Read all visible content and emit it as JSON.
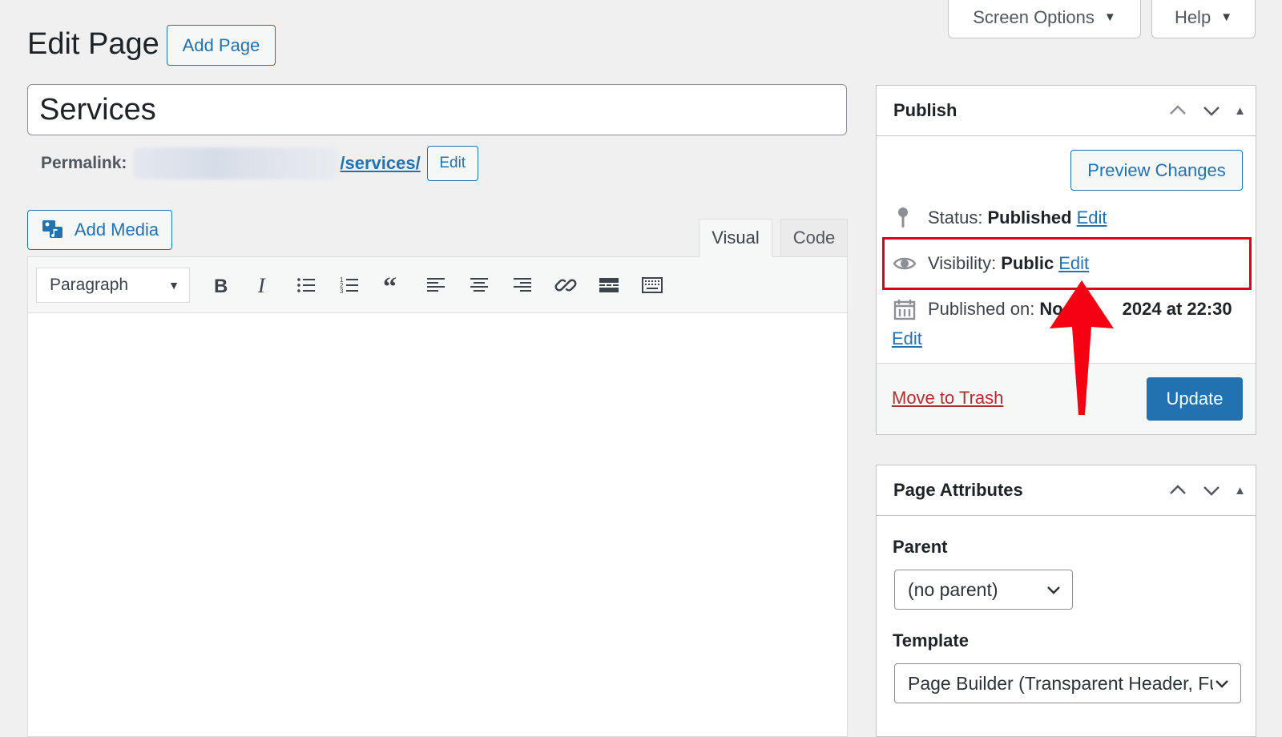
{
  "top_tabs": {
    "screen_options": "Screen Options",
    "help": "Help"
  },
  "header": {
    "title": "Edit Page",
    "add_new": "Add Page"
  },
  "post": {
    "title": "Services"
  },
  "permalink": {
    "label": "Permalink:",
    "slug": "/services/",
    "edit": "Edit"
  },
  "editor": {
    "add_media": "Add Media",
    "tabs": {
      "visual": "Visual",
      "code": "Code"
    },
    "format": "Paragraph"
  },
  "publish": {
    "heading": "Publish",
    "preview": "Preview Changes",
    "status_label": "Status:",
    "status_value": "Published",
    "visibility_label": "Visibility:",
    "visibility_value": "Public",
    "published_label": "Published on:",
    "published_value": "No",
    "published_value_tail": "2024 at 22:30",
    "edit": "Edit",
    "trash": "Move to Trash",
    "update": "Update"
  },
  "attributes": {
    "heading": "Page Attributes",
    "parent_label": "Parent",
    "parent_value": "(no parent)",
    "template_label": "Template",
    "template_value": "Page Builder (Transparent Header, Full Width)"
  },
  "colors": {
    "accent": "#2271b1",
    "highlight": "#e10012",
    "danger": "#b32d2e"
  },
  "icons": [
    "chevron-up-icon",
    "chevron-down-icon",
    "collapse-icon",
    "pin-icon",
    "eye-icon",
    "calendar-icon",
    "media-icon",
    "arrow-icon"
  ]
}
